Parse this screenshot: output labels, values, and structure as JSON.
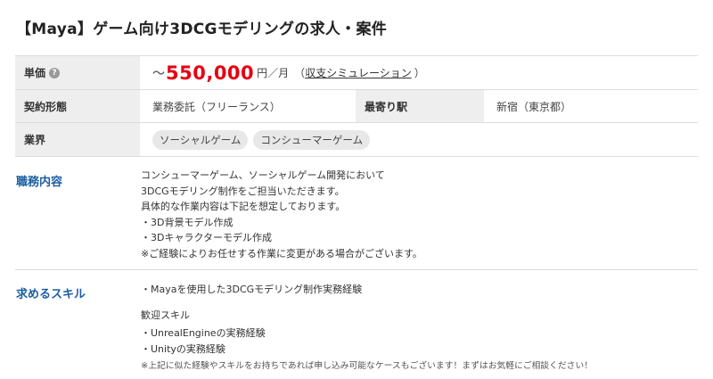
{
  "title": "【Maya】ゲーム向け3DCGモデリングの求人・案件",
  "rate": {
    "label": "単価",
    "help_icon": "?",
    "prefix": "～",
    "value": "550,000",
    "unit": "円／月",
    "paren_open": "（",
    "link": "収支シミュレーション",
    "paren_close": "）",
    "value_color": "#e60012"
  },
  "contract": {
    "label": "契約形態",
    "value": "業務委託（フリーランス）"
  },
  "station": {
    "label": "最寄り駅",
    "value": "新宿（東京都）"
  },
  "industry": {
    "label": "業界",
    "tags": [
      "ソーシャルゲーム",
      "コンシューマーゲーム"
    ]
  },
  "duties": {
    "label": "職務内容",
    "lines": [
      "コンシューマーゲーム、ソーシャルゲーム開発において",
      "3DCGモデリング制作をご担当いただきます。",
      "具体的な作業内容は下記を想定しております。",
      "・3D背景モデル作成",
      "・3Dキャラクターモデル作成",
      "※ご経験によりお任せする作業に変更がある場合がございます。"
    ]
  },
  "skills": {
    "label": "求めるスキル",
    "required": [
      "・Mayaを使用した3DCGモデリング制作実務経験"
    ],
    "welcome_heading": "歓迎スキル",
    "welcome": [
      "・UnrealEngineの実務経験",
      "・Unityの実務経験"
    ],
    "note": "※上記に似た経験やスキルをお持ちであれば申し込み可能なケースもございます！まずはお気軽にご相談ください！"
  },
  "accent_color": "#1d5fa3"
}
